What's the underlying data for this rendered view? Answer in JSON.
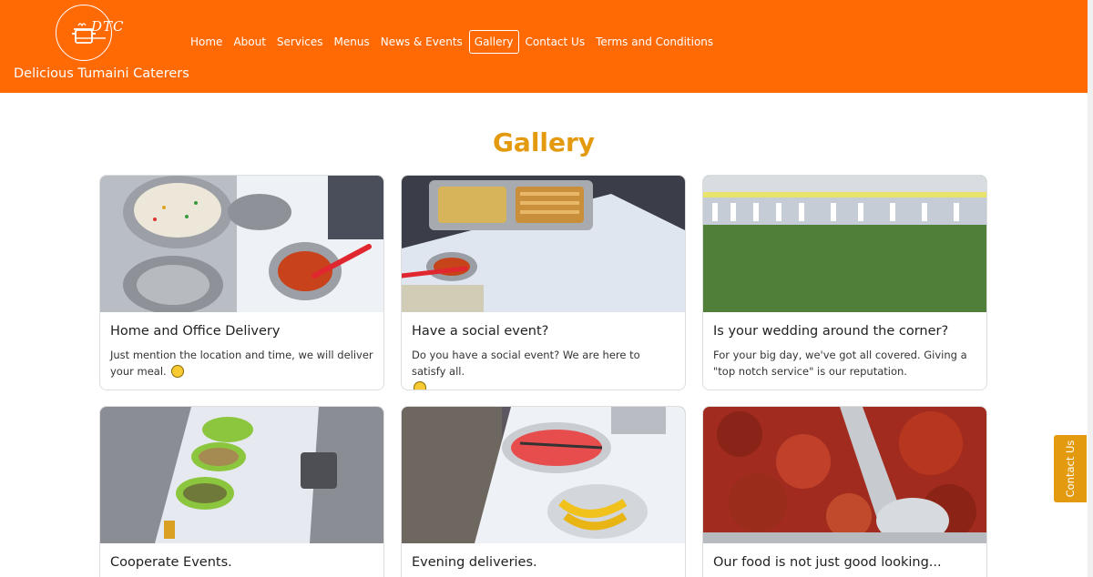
{
  "brand": {
    "logo_text": "DTC",
    "name": "Delicious Tumaini Caterers"
  },
  "nav": {
    "items": [
      {
        "label": "Home"
      },
      {
        "label": "About"
      },
      {
        "label": "Services"
      },
      {
        "label": "Menus"
      },
      {
        "label": "News & Events"
      },
      {
        "label": "Gallery",
        "active": true
      },
      {
        "label": "Contact Us"
      },
      {
        "label": "Terms and Conditions"
      }
    ]
  },
  "page": {
    "title": "Gallery"
  },
  "cards": [
    {
      "title": "Home and Office Delivery",
      "text": "Just mention the location and time, we will deliver your meal.",
      "emoji": "yum-face-icon"
    },
    {
      "title": "Have a social event?",
      "text": "Do you have a social event? We are here to satisfy all.",
      "emoji": "food-emoji-icon"
    },
    {
      "title": "Is your wedding around the corner?",
      "text": "For your big day, we've got all covered. Giving a \"top notch service\" is our reputation."
    },
    {
      "title": "Cooperate Events.",
      "text": ""
    },
    {
      "title": "Evening deliveries.",
      "text": ""
    },
    {
      "title": "Our food is not just good looking...",
      "text": ""
    }
  ],
  "side_tab": {
    "label": "Contact Us"
  },
  "colors": {
    "header": "#ff6a05",
    "accent": "#e39a0f"
  }
}
